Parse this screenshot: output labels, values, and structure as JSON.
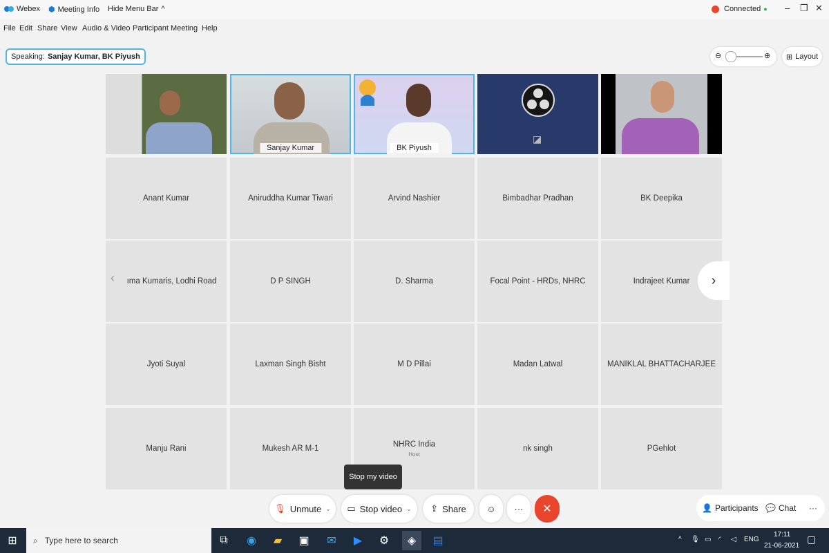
{
  "titlebar": {
    "app": "Webex",
    "meeting_info": "Meeting Info",
    "hide_menu": "Hide Menu Bar",
    "status": "Connected",
    "status_color": "#2ab04a"
  },
  "menu": [
    "File",
    "Edit",
    "Share",
    "View",
    "Audio & Video",
    "Participant",
    "Meeting",
    "Help"
  ],
  "speaking": {
    "label": "Speaking:",
    "names": "Sanjay Kumar, BK Piyush"
  },
  "layout_label": "Layout",
  "videos": [
    {
      "name": ""
    },
    {
      "name": "Sanjay Kumar"
    },
    {
      "name": "BK Piyush"
    },
    {
      "name": ""
    },
    {
      "name": ""
    }
  ],
  "participants": [
    {
      "name": "Anant Kumar",
      "sub": ""
    },
    {
      "name": "Aniruddha Kumar Tiwari",
      "sub": ""
    },
    {
      "name": "Arvind Nashier",
      "sub": ""
    },
    {
      "name": "Bimbadhar Pradhan",
      "sub": ""
    },
    {
      "name": "BK Deepika",
      "sub": ""
    },
    {
      "name": "ıma Kumaris, Lodhi Road",
      "sub": ""
    },
    {
      "name": "D P SINGH",
      "sub": ""
    },
    {
      "name": "D. Sharma",
      "sub": ""
    },
    {
      "name": "Focal Point - HRDs, NHRC",
      "sub": ""
    },
    {
      "name": "Indrajeet Kumar",
      "sub": ""
    },
    {
      "name": "Jyoti Suyal",
      "sub": ""
    },
    {
      "name": "Laxman Singh Bisht",
      "sub": ""
    },
    {
      "name": "M D Pillai",
      "sub": ""
    },
    {
      "name": "Madan Latwal",
      "sub": ""
    },
    {
      "name": "MANIKLAL BHATTACHARJEE",
      "sub": ""
    },
    {
      "name": "Manju Rani",
      "sub": ""
    },
    {
      "name": "Mukesh AR M-1",
      "sub": ""
    },
    {
      "name": "NHRC India",
      "sub": "Host"
    },
    {
      "name": "nk singh",
      "sub": ""
    },
    {
      "name": "PGehlot",
      "sub": ""
    }
  ],
  "tooltip": "Stop my video",
  "controls": {
    "unmute": "Unmute",
    "stop_video": "Stop video",
    "share": "Share",
    "participants": "Participants",
    "chat": "Chat"
  },
  "taskbar": {
    "search_placeholder": "Type here to search",
    "lang": "ENG",
    "time": "17:11",
    "date": "21-06-2021"
  }
}
